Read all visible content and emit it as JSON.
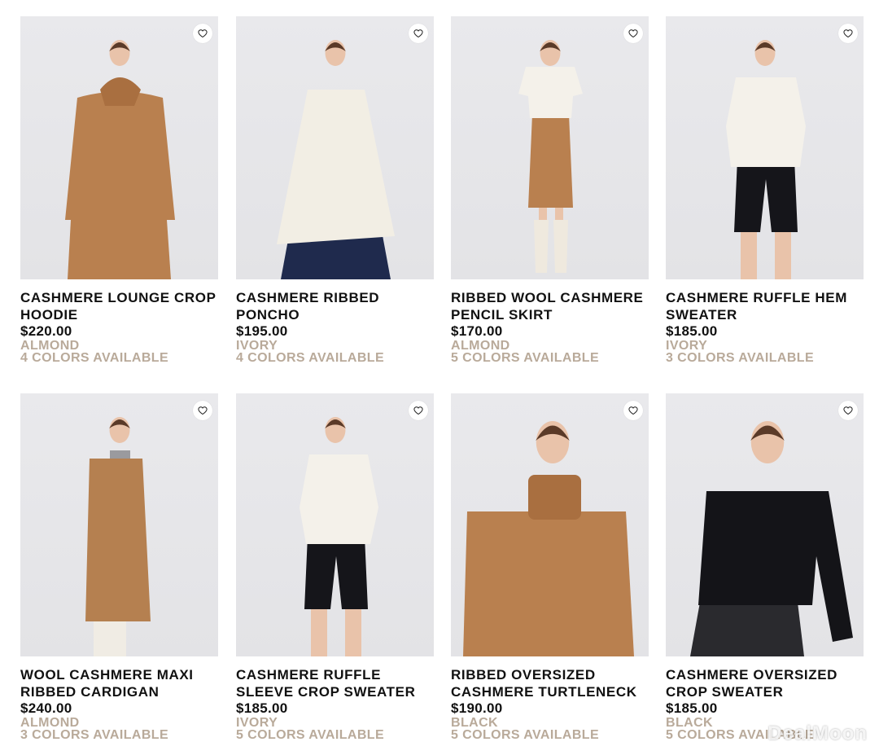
{
  "products": [
    {
      "name_line1": "CASHMERE LOUNGE CROP",
      "name_line2": "HOODIE",
      "price": "$220.00",
      "color": "ALMOND",
      "availability": "4 COLORS AVAILABLE",
      "garment_color": "#b9804f",
      "bottom_color": "#b9804f",
      "style": "hoodie"
    },
    {
      "name_line1": "CASHMERE RIBBED",
      "name_line2": "PONCHO",
      "price": "$195.00",
      "color": "IVORY",
      "availability": "4 COLORS AVAILABLE",
      "garment_color": "#f2eee4",
      "bottom_color": "#1f2a4d",
      "style": "poncho"
    },
    {
      "name_line1": "RIBBED WOOL CASHMERE",
      "name_line2": "PENCIL SKIRT",
      "price": "$170.00",
      "color": "ALMOND",
      "availability": "5 COLORS AVAILABLE",
      "garment_color": "#f4f1ea",
      "bottom_color": "#b9804f",
      "style": "skirt"
    },
    {
      "name_line1": "CASHMERE RUFFLE HEM",
      "name_line2": "SWEATER",
      "price": "$185.00",
      "color": "IVORY",
      "availability": "3 COLORS AVAILABLE",
      "garment_color": "#f4f1ea",
      "bottom_color": "#15151a",
      "style": "ruffle"
    },
    {
      "name_line1": "WOOL CASHMERE MAXI",
      "name_line2": "RIBBED CARDIGAN",
      "price": "$240.00",
      "color": "ALMOND",
      "availability": "3 COLORS AVAILABLE",
      "garment_color": "#b58050",
      "bottom_color": "#9a9a9e",
      "style": "cardigan"
    },
    {
      "name_line1": "CASHMERE RUFFLE",
      "name_line2": "SLEEVE CROP SWEATER",
      "price": "$185.00",
      "color": "IVORY",
      "availability": "5 COLORS AVAILABLE",
      "garment_color": "#f4f1ea",
      "bottom_color": "#15151a",
      "style": "crop"
    },
    {
      "name_line1": "RIBBED OVERSIZED",
      "name_line2": "CASHMERE TURTLENECK",
      "price": "$190.00",
      "color": "BLACK",
      "availability": "5 COLORS AVAILABLE",
      "garment_color": "#b9804f",
      "bottom_color": "#b9804f",
      "style": "turtleneck"
    },
    {
      "name_line1": "CASHMERE OVERSIZED",
      "name_line2": "CROP SWEATER",
      "price": "$185.00",
      "color": "BLACK",
      "availability": "5 COLORS AVAILABLE",
      "garment_color": "#141418",
      "bottom_color": "#2a2a2e",
      "style": "oversized"
    }
  ],
  "watermark": "DealMoon",
  "colors": {
    "accent_text": "#b9aa9a",
    "text": "#111111",
    "photo_bg": "#e6e6e9"
  },
  "icons": {
    "favorite": "heart-outline-icon"
  }
}
